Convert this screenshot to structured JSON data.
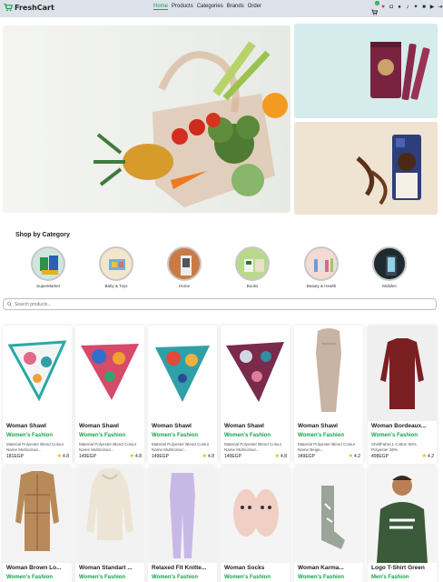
{
  "brand": "FreshCart",
  "nav": {
    "links": [
      "Home",
      "Products",
      "Categories",
      "Brands",
      "Order"
    ],
    "cart_count": "0"
  },
  "icons": [
    "cart-icon",
    "heart-icon",
    "instagram-icon",
    "facebook-icon",
    "tiktok-icon",
    "twitter-icon",
    "linkedin-icon",
    "youtube-icon",
    "logout-icon"
  ],
  "categories": {
    "title": "Shop by Category",
    "items": [
      "SuperMarket",
      "Baby & Toys",
      "Home",
      "Books",
      "Beauty & Health",
      "Mobiles"
    ]
  },
  "search": {
    "placeholder": "Search products..."
  },
  "products": [
    {
      "title": "Woman Shawl",
      "category": "Women's Fashion",
      "desc": "Material Polyester Blend Colour Name Multicolour...",
      "price": "181EGP",
      "rating": "4.8"
    },
    {
      "title": "Woman Shawl",
      "category": "Women's Fashion",
      "desc": "Material Polyester Blend Colour Name Multicolour...",
      "price": "149EGP",
      "rating": "4.8"
    },
    {
      "title": "Woman Shawl",
      "category": "Women's Fashion",
      "desc": "Material Polyester Blend Colour Name Multicolour...",
      "price": "149EGP",
      "rating": "4.8"
    },
    {
      "title": "Woman Shawl",
      "category": "Women's Fashion",
      "desc": "Material Polyester Blend Colour Name Multicolour...",
      "price": "149EGP",
      "rating": "4.8"
    },
    {
      "title": "Woman Shawl",
      "category": "Women's Fashion",
      "desc": "Material Polyester Blend Colour Name Beige...",
      "price": "349EGP",
      "rating": "4.2"
    },
    {
      "title": "Woman Bordeaux...",
      "category": "Women's Fashion",
      "desc": "ShellFabric1 Cotton 65% Polyester 35%",
      "price": "498EGP",
      "rating": "4.2"
    },
    {
      "title": "Woman Brown Lo...",
      "category": "Women's Fashion",
      "desc": "",
      "price": "",
      "rating": ""
    },
    {
      "title": "Woman Standart ...",
      "category": "Women's Fashion",
      "desc": "",
      "price": "",
      "rating": ""
    },
    {
      "title": "Relaxed Fit Knitte...",
      "category": "Women's Fashion",
      "desc": "",
      "price": "",
      "rating": ""
    },
    {
      "title": "Woman Socks",
      "category": "Women's Fashion",
      "desc": "",
      "price": "",
      "rating": ""
    },
    {
      "title": "Woman Karma...",
      "category": "Women's Fashion",
      "desc": "",
      "price": "",
      "rating": ""
    },
    {
      "title": "Logo T-Shirt Green",
      "category": "Men's Fashion",
      "desc": "",
      "price": "",
      "rating": ""
    }
  ],
  "colors": {
    "accent": "#16a34a",
    "navbar": "#dbe2ea",
    "star": "#eab308"
  }
}
